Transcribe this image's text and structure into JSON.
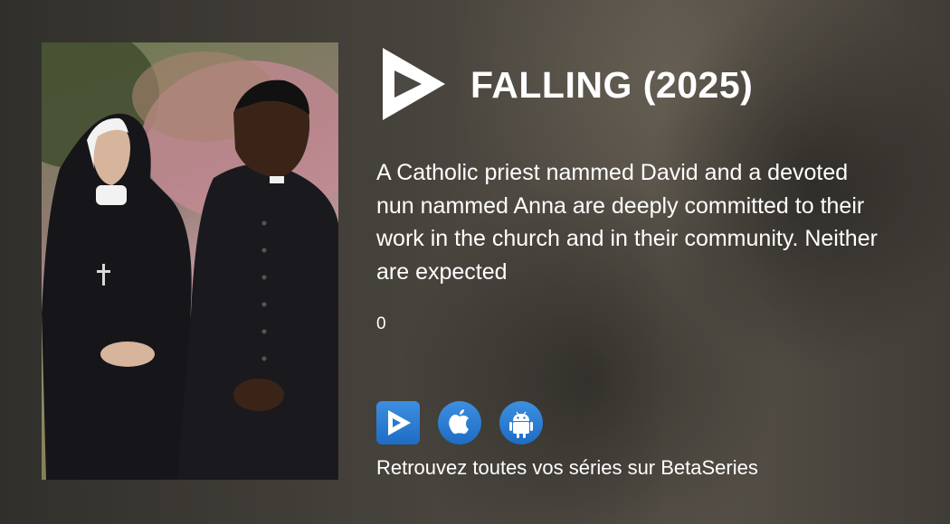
{
  "show": {
    "title": "FALLING (2025)",
    "synopsis": "A Catholic priest nammed David and a devoted nun nammed Anna are deeply committed to their work in the church and in their community. Neither are expected",
    "rating": "0"
  },
  "apps": {
    "tagline": "Retrouvez toutes vos séries sur BetaSeries",
    "icons": [
      "betaseries-web-icon",
      "apple-icon",
      "android-icon"
    ]
  },
  "colors": {
    "accent": "#2f80d8",
    "text": "#ffffff"
  }
}
